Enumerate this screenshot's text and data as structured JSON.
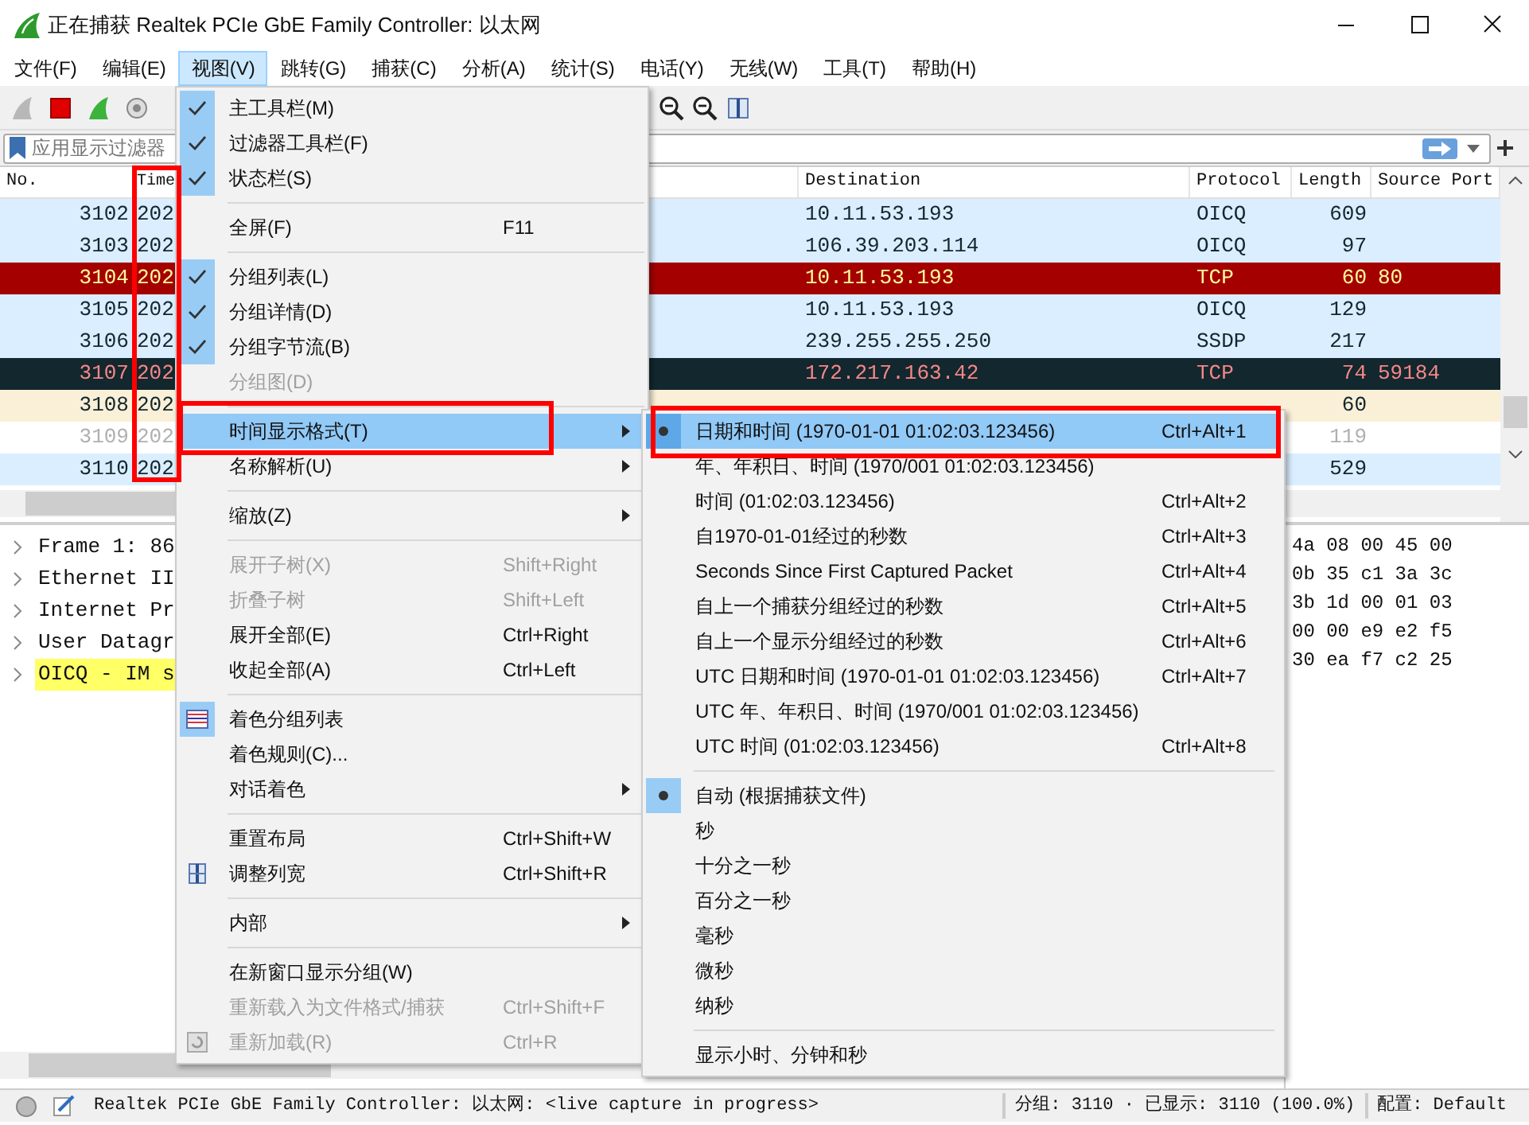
{
  "window": {
    "title": "正在捕获 Realtek PCIe GbE Family Controller: 以太网"
  },
  "menubar": [
    {
      "label": "文件(F)",
      "selected": false
    },
    {
      "label": "编辑(E)",
      "selected": false
    },
    {
      "label": "视图(V)",
      "selected": true
    },
    {
      "label": "跳转(G)",
      "selected": false
    },
    {
      "label": "捕获(C)",
      "selected": false
    },
    {
      "label": "分析(A)",
      "selected": false
    },
    {
      "label": "统计(S)",
      "selected": false
    },
    {
      "label": "电话(Y)",
      "selected": false
    },
    {
      "label": "无线(W)",
      "selected": false
    },
    {
      "label": "工具(T)",
      "selected": false
    },
    {
      "label": "帮助(H)",
      "selected": false
    }
  ],
  "filter": {
    "placeholder": "应用显示过滤器"
  },
  "packet_list": {
    "columns": [
      "No.",
      "Time",
      "Destination",
      "Protocol",
      "Length",
      "Source Port"
    ],
    "rows": [
      {
        "kind": "normal",
        "no": "3102",
        "time": "202",
        "destination": "10.11.53.193",
        "protocol": "OICQ",
        "length": "609"
      },
      {
        "kind": "normal",
        "no": "3103",
        "time": "202",
        "destination": "106.39.203.114",
        "protocol": "OICQ",
        "length": "97"
      },
      {
        "kind": "error",
        "no": "3104",
        "time": "202",
        "destination": "10.11.53.193",
        "protocol": "TCP",
        "length": "60",
        "source_port": "80"
      },
      {
        "kind": "normal",
        "no": "3105",
        "time": "202",
        "destination": "10.11.53.193",
        "protocol": "OICQ",
        "length": "129"
      },
      {
        "kind": "normal",
        "no": "3106",
        "time": "202",
        "destination": "239.255.255.250",
        "protocol": "SSDP",
        "length": "217"
      },
      {
        "kind": "dark",
        "no": "3107",
        "time": "202",
        "destination": "172.217.163.42",
        "protocol": "TCP",
        "length": "74",
        "source_port": "59184"
      },
      {
        "kind": "arp",
        "no": "3108",
        "time": "202",
        "length": "60"
      },
      {
        "kind": "dim",
        "no": "3109",
        "time": "202",
        "length": "119"
      },
      {
        "kind": "normal",
        "no": "3110",
        "time": "202",
        "length": "529"
      }
    ]
  },
  "details": [
    {
      "label": "Frame 1: 86",
      "expanded": false,
      "highlighted": false
    },
    {
      "label": "Ethernet II",
      "expanded": false,
      "highlighted": false
    },
    {
      "label": "Internet Pr",
      "expanded": false,
      "highlighted": false
    },
    {
      "label": "User Datagr",
      "expanded": false,
      "highlighted": false
    },
    {
      "label": "OICQ - IM s",
      "expanded": false,
      "highlighted": true
    }
  ],
  "bytes": [
    "4a 08 00 45 00",
    "0b 35 c1 3a 3c",
    "3b 1d 00 01 03",
    "00 00 e9 e2 f5",
    "30 ea f7 c2 25"
  ],
  "view_menu": {
    "items": [
      {
        "kind": "item",
        "label": "主工具栏(M)",
        "checked": true,
        "disabled": false,
        "selected": false
      },
      {
        "kind": "item",
        "label": "过滤器工具栏(F)",
        "checked": true,
        "disabled": false,
        "selected": false
      },
      {
        "kind": "item",
        "label": "状态栏(S)",
        "checked": true,
        "disabled": false,
        "selected": false
      },
      {
        "kind": "separator"
      },
      {
        "kind": "item",
        "label": "全屏(F)",
        "shortcut": "F11",
        "checked": false,
        "disabled": false,
        "selected": false
      },
      {
        "kind": "separator"
      },
      {
        "kind": "item",
        "label": "分组列表(L)",
        "checked": true,
        "disabled": false,
        "selected": false
      },
      {
        "kind": "item",
        "label": "分组详情(D)",
        "checked": true,
        "disabled": false,
        "selected": false
      },
      {
        "kind": "item",
        "label": "分组字节流(B)",
        "checked": true,
        "disabled": false,
        "selected": false
      },
      {
        "kind": "item",
        "label": "分组图(D)",
        "checked": false,
        "disabled": true,
        "selected": false
      },
      {
        "kind": "separator"
      },
      {
        "kind": "submenu",
        "label": "时间显示格式(T)",
        "checked": false,
        "disabled": false,
        "selected": true
      },
      {
        "kind": "submenu",
        "label": "名称解析(U)",
        "checked": false,
        "disabled": false,
        "selected": false
      },
      {
        "kind": "separator"
      },
      {
        "kind": "submenu",
        "label": "缩放(Z)",
        "checked": false,
        "disabled": false,
        "selected": false
      },
      {
        "kind": "separator"
      },
      {
        "kind": "item",
        "label": "展开子树(X)",
        "shortcut": "Shift+Right",
        "checked": false,
        "disabled": true,
        "selected": false
      },
      {
        "kind": "item",
        "label": "折叠子树",
        "shortcut": "Shift+Left",
        "checked": false,
        "disabled": true,
        "selected": false
      },
      {
        "kind": "item",
        "label": "展开全部(E)",
        "shortcut": "Ctrl+Right",
        "checked": false,
        "disabled": false,
        "selected": false
      },
      {
        "kind": "item",
        "label": "收起全部(A)",
        "shortcut": "Ctrl+Left",
        "checked": false,
        "disabled": false,
        "selected": false
      },
      {
        "kind": "separator"
      },
      {
        "kind": "colorize",
        "label": "着色分组列表",
        "checked": true,
        "disabled": false,
        "selected": false
      },
      {
        "kind": "item",
        "label": "着色规则(C)...",
        "checked": false,
        "disabled": false,
        "selected": false
      },
      {
        "kind": "submenu",
        "label": "对话着色",
        "checked": false,
        "disabled": false,
        "selected": false
      },
      {
        "kind": "separator"
      },
      {
        "kind": "item",
        "label": "重置布局",
        "shortcut": "Ctrl+Shift+W",
        "checked": false,
        "disabled": false,
        "selected": false
      },
      {
        "kind": "resize",
        "label": "调整列宽",
        "shortcut": "Ctrl+Shift+R",
        "checked": false,
        "disabled": false,
        "selected": false
      },
      {
        "kind": "separator"
      },
      {
        "kind": "submenu",
        "label": "内部",
        "checked": false,
        "disabled": false,
        "selected": false
      },
      {
        "kind": "separator"
      },
      {
        "kind": "item",
        "label": "在新窗口显示分组(W)",
        "checked": false,
        "disabled": false,
        "selected": false
      },
      {
        "kind": "item",
        "label": "重新载入为文件格式/捕获",
        "shortcut": "Ctrl+Shift+F",
        "checked": false,
        "disabled": true,
        "selected": false
      },
      {
        "kind": "reload",
        "label": "重新加载(R)",
        "shortcut": "Ctrl+R",
        "checked": false,
        "disabled": true,
        "selected": false
      }
    ]
  },
  "time_format_menu": {
    "items": [
      {
        "kind": "item",
        "label": "日期和时间 (1970-01-01 01:02:03.123456)",
        "shortcut": "Ctrl+Alt+1",
        "checked": true,
        "selected": true
      },
      {
        "kind": "item",
        "label": "年、年积日、时间 (1970/001 01:02:03.123456)",
        "checked": false,
        "selected": false
      },
      {
        "kind": "item",
        "label": "时间 (01:02:03.123456)",
        "shortcut": "Ctrl+Alt+2",
        "checked": false,
        "selected": false
      },
      {
        "kind": "item",
        "label": "自1970-01-01经过的秒数",
        "shortcut": "Ctrl+Alt+3",
        "checked": false,
        "selected": false
      },
      {
        "kind": "item",
        "label": "Seconds Since First Captured Packet",
        "shortcut": "Ctrl+Alt+4",
        "checked": false,
        "selected": false
      },
      {
        "kind": "item",
        "label": "自上一个捕获分组经过的秒数",
        "shortcut": "Ctrl+Alt+5",
        "checked": false,
        "selected": false
      },
      {
        "kind": "item",
        "label": "自上一个显示分组经过的秒数",
        "shortcut": "Ctrl+Alt+6",
        "checked": false,
        "selected": false
      },
      {
        "kind": "item",
        "label": "UTC 日期和时间 (1970-01-01 01:02:03.123456)",
        "shortcut": "Ctrl+Alt+7",
        "checked": false,
        "selected": false
      },
      {
        "kind": "item",
        "label": "UTC 年、年积日、时间 (1970/001 01:02:03.123456)",
        "checked": false,
        "selected": false
      },
      {
        "kind": "item",
        "label": "UTC 时间 (01:02:03.123456)",
        "shortcut": "Ctrl+Alt+8",
        "checked": false,
        "selected": false
      },
      {
        "kind": "separator"
      },
      {
        "kind": "item",
        "label": "自动 (根据捕获文件)",
        "checked": true,
        "selected": false
      },
      {
        "kind": "item",
        "label": "秒",
        "checked": false,
        "selected": false
      },
      {
        "kind": "item",
        "label": "十分之一秒",
        "checked": false,
        "selected": false
      },
      {
        "kind": "item",
        "label": "百分之一秒",
        "checked": false,
        "selected": false
      },
      {
        "kind": "item",
        "label": "毫秒",
        "checked": false,
        "selected": false
      },
      {
        "kind": "item",
        "label": "微秒",
        "checked": false,
        "selected": false
      },
      {
        "kind": "item",
        "label": "纳秒",
        "checked": false,
        "selected": false
      },
      {
        "kind": "separator"
      },
      {
        "kind": "item",
        "label": "显示小时、分钟和秒",
        "checked": false,
        "selected": false
      }
    ]
  },
  "status_bar": {
    "capture": "Realtek PCIe GbE Family Controller: 以太网: <live capture in progress>",
    "counts": "分组: 3110 · 已显示: 3110 (100.0%)",
    "profile": "配置: Default"
  }
}
